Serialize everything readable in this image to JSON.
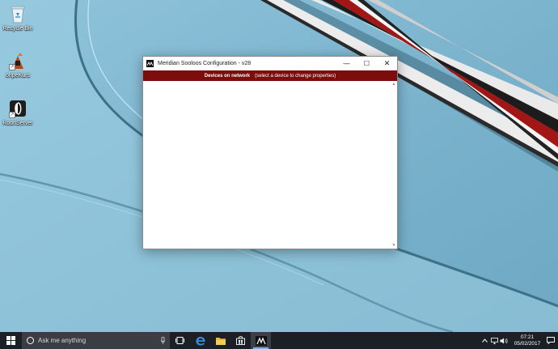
{
  "desktop": {
    "icons": [
      {
        "label": "Recycle Bin",
        "icon": "recycle-bin-icon"
      },
      {
        "label": "ohpeKurs",
        "icon": "app-shortcut-icon"
      },
      {
        "label": "RoonServer",
        "icon": "roon-server-icon"
      }
    ]
  },
  "window": {
    "title": "Meridian Sooloos Configuration - v28",
    "buttons": {
      "minimize": "—",
      "maximize": "☐",
      "close": "✕"
    },
    "banner": {
      "heading": "Devices on network",
      "hint": "(select a device to change properties)"
    },
    "scroll": {
      "up": "▲",
      "down": "▼"
    }
  },
  "taskbar": {
    "search_placeholder": "Ask me anything",
    "clock": {
      "time": "07:21",
      "date": "05/02/2017"
    }
  },
  "colors": {
    "banner": "#7d0c0c",
    "taskbar": "#1b2026",
    "wallpaper": "#7fb6cf"
  }
}
